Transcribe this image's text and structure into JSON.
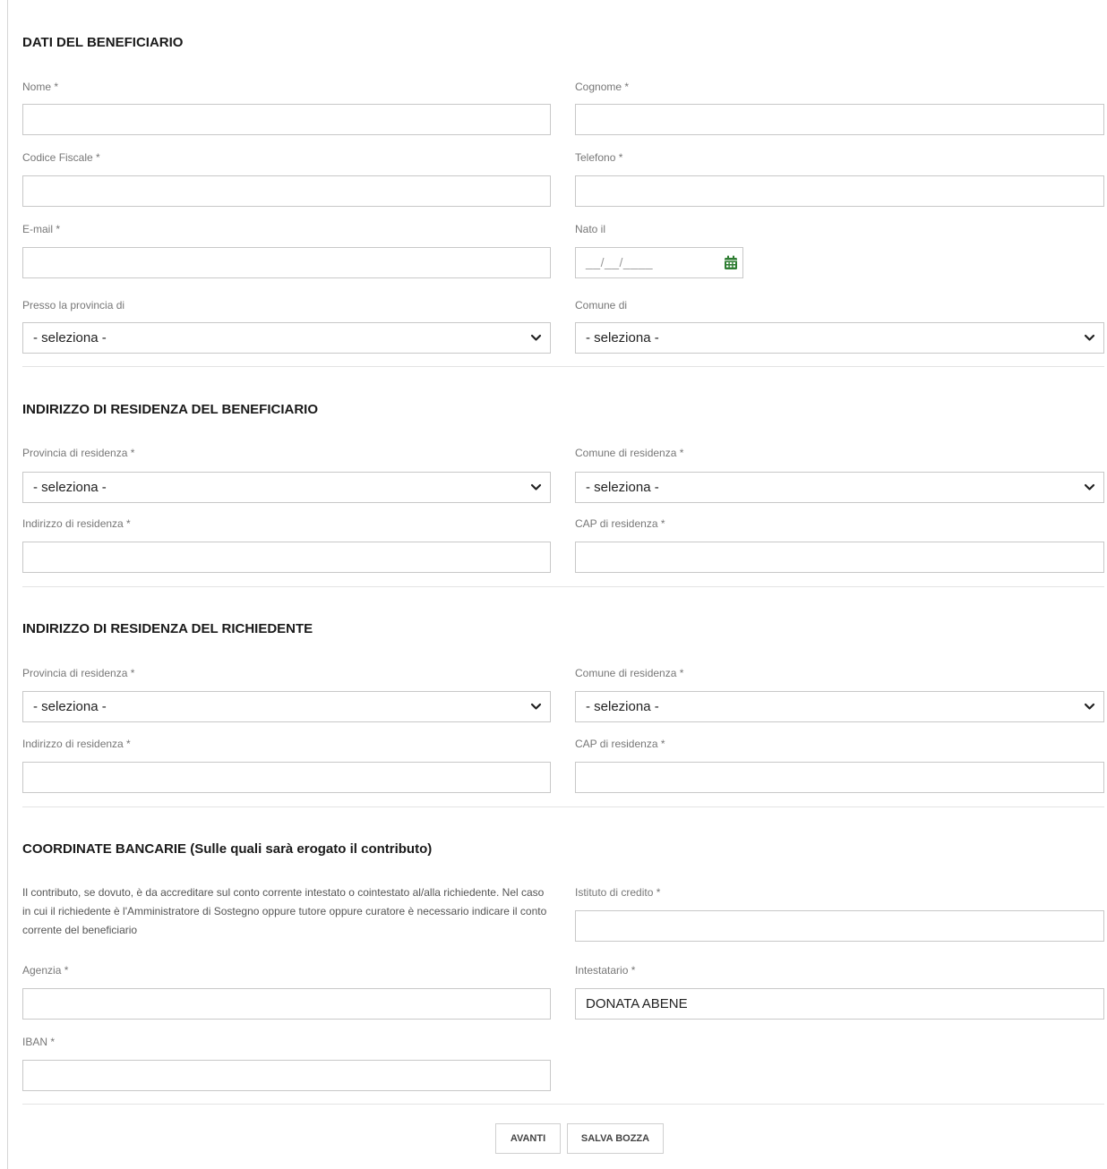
{
  "sections": {
    "beneficiario": {
      "title": "DATI DEL BENEFICIARIO",
      "nome_label": "Nome *",
      "cognome_label": "Cognome *",
      "codice_fiscale_label": "Codice Fiscale *",
      "telefono_label": "Telefono *",
      "email_label": "E-mail *",
      "nato_il_label": "Nato il",
      "nato_il_mask": "__/__/____",
      "provincia_label": "Presso la provincia di",
      "comune_label": "Comune di",
      "provincia_value": "- seleziona -",
      "comune_value": "- seleziona -"
    },
    "residenza_beneficiario": {
      "title": "INDIRIZZO DI RESIDENZA DEL BENEFICIARIO",
      "provincia_label": "Provincia di residenza *",
      "comune_label": "Comune di residenza *",
      "provincia_value": "- seleziona -",
      "comune_value": "- seleziona -",
      "indirizzo_label": "Indirizzo di residenza *",
      "cap_label": "CAP di residenza *"
    },
    "residenza_richiedente": {
      "title": "INDIRIZZO DI RESIDENZA DEL RICHIEDENTE",
      "provincia_label": "Provincia di residenza *",
      "comune_label": "Comune di residenza *",
      "provincia_value": "- seleziona -",
      "comune_value": "- seleziona -",
      "indirizzo_label": "Indirizzo di residenza *",
      "cap_label": "CAP di residenza *"
    },
    "bancarie": {
      "title": "COORDINATE BANCARIE (Sulle quali sarà erogato il contributo)",
      "note": "Il contributo, se dovuto, è da accreditare sul conto corrente intestato o cointestato al/alla richiedente. Nel caso in cui il richiedente è l'Amministratore di Sostegno oppure tutore oppure curatore è necessario indicare il conto corrente del beneficiario",
      "istituto_label": "Istituto di credito *",
      "agenzia_label": "Agenzia *",
      "intestatario_label": "Intestatario *",
      "intestatario_value": "DONATA ABENE",
      "iban_label": "IBAN *"
    }
  },
  "actions": {
    "avanti_label": "AVANTI",
    "salva_bozza_label": "SALVA BOZZA"
  },
  "colors": {
    "calendar_icon": "#2e7d32",
    "border": "#c8c8c8"
  }
}
